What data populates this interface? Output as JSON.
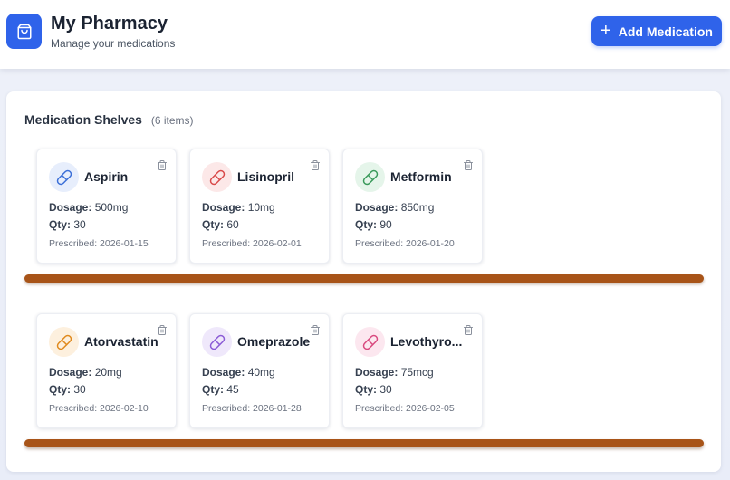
{
  "header": {
    "title": "My Pharmacy",
    "subtitle": "Manage your medications",
    "add_button_label": "Add Medication",
    "accent": "#2f63ea"
  },
  "main": {
    "section_title": "Medication Shelves",
    "item_count": "(6 items)",
    "shelves": [
      {
        "medications": [
          {
            "name": "Aspirin",
            "dosage_label": "Dosage:",
            "dosage": "500mg",
            "qty_label": "Qty:",
            "qty": "30",
            "prescribed": "Prescribed: 2026-01-15",
            "color": "#3b6fd8",
            "bg": "#e7eefc"
          },
          {
            "name": "Lisinopril",
            "dosage_label": "Dosage:",
            "dosage": "10mg",
            "qty_label": "Qty:",
            "qty": "60",
            "prescribed": "Prescribed: 2026-02-01",
            "color": "#d94a4a",
            "bg": "#fce8e8"
          },
          {
            "name": "Metformin",
            "dosage_label": "Dosage:",
            "dosage": "850mg",
            "qty_label": "Qty:",
            "qty": "90",
            "prescribed": "Prescribed: 2026-01-20",
            "color": "#3a9a5b",
            "bg": "#e5f5ea"
          }
        ]
      },
      {
        "medications": [
          {
            "name": "Atorvastatin",
            "dosage_label": "Dosage:",
            "dosage": "20mg",
            "qty_label": "Qty:",
            "qty": "30",
            "prescribed": "Prescribed: 2026-02-10",
            "color": "#e08a1e",
            "bg": "#fdf0de"
          },
          {
            "name": "Omeprazole",
            "dosage_label": "Dosage:",
            "dosage": "40mg",
            "qty_label": "Qty:",
            "qty": "45",
            "prescribed": "Prescribed: 2026-01-28",
            "color": "#8b5cd6",
            "bg": "#efe8fb"
          },
          {
            "name": "Levothyro...",
            "dosage_label": "Dosage:",
            "dosage": "75mcg",
            "qty_label": "Qty:",
            "qty": "30",
            "prescribed": "Prescribed: 2026-02-05",
            "color": "#d94a7f",
            "bg": "#fce7ef"
          }
        ]
      }
    ],
    "shelf_color": "#a85418"
  },
  "icons": {
    "logo": "shopping-bag-icon",
    "add": "plus-icon",
    "pill": "pill-icon",
    "delete": "trash-icon"
  }
}
